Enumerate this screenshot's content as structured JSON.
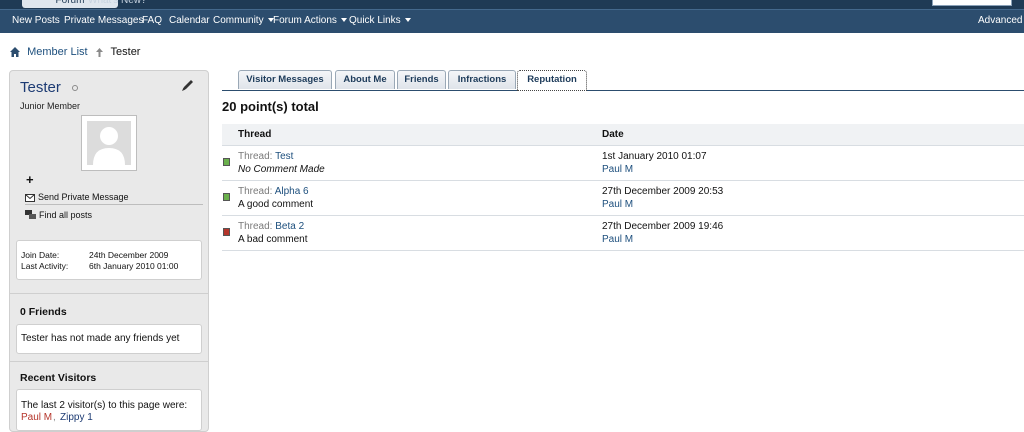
{
  "colors": {
    "navbar": "#2c4d6e",
    "topbar": "#1f3a55",
    "link": "#1d4f7d",
    "positive": "#6ab04c",
    "negative": "#b5352b"
  },
  "top_tabs": {
    "forum": "Forum",
    "whats_new": "What's New?"
  },
  "navbar": {
    "items": [
      {
        "label": "New Posts",
        "dropdown": false
      },
      {
        "label": "Private Messages",
        "dropdown": false
      },
      {
        "label": "FAQ",
        "dropdown": false
      },
      {
        "label": "Calendar",
        "dropdown": false
      },
      {
        "label": "Community",
        "dropdown": true
      },
      {
        "label": "Forum Actions",
        "dropdown": true
      },
      {
        "label": "Quick Links",
        "dropdown": true
      }
    ],
    "advanced": "Advanced S"
  },
  "breadcrumb": {
    "home_icon": "home-icon",
    "member_list": "Member List",
    "current": "Tester"
  },
  "profile": {
    "username": "Tester",
    "user_title": "Junior Member",
    "plus": "+",
    "send_pm": "Send Private Message",
    "find_posts": "Find all posts",
    "join_date_label": "Join Date:",
    "join_date": "24th December 2009",
    "last_activity_label": "Last Activity:",
    "last_activity": "6th January 2010 01:00",
    "friends_heading": "0 Friends",
    "friends_text": "Tester has not made any friends yet",
    "visitors_heading": "Recent Visitors",
    "visitors_text": "The last 2 visitor(s) to this page were:",
    "visitors": [
      "Paul M",
      "Zippy 1"
    ]
  },
  "tabs": [
    {
      "label": "Visitor Messages",
      "active": false
    },
    {
      "label": "About Me",
      "active": false
    },
    {
      "label": "Friends",
      "active": false
    },
    {
      "label": "Infractions",
      "active": false
    },
    {
      "label": "Reputation",
      "active": true
    }
  ],
  "reputation": {
    "total": "20 point(s) total",
    "columns": [
      "Thread",
      "Date"
    ],
    "thread_prefix": "Thread:",
    "rows": [
      {
        "type": "positive",
        "thread": "Test",
        "comment": "No Comment Made",
        "italic": true,
        "date": "1st January 2010 01:07",
        "by": "Paul M"
      },
      {
        "type": "positive",
        "thread": "Alpha 6",
        "comment": "A good comment",
        "italic": false,
        "date": "27th December 2009 20:53",
        "by": "Paul M"
      },
      {
        "type": "negative",
        "thread": "Beta 2",
        "comment": "A bad comment",
        "italic": false,
        "date": "27th December 2009 19:46",
        "by": "Paul M"
      }
    ]
  }
}
